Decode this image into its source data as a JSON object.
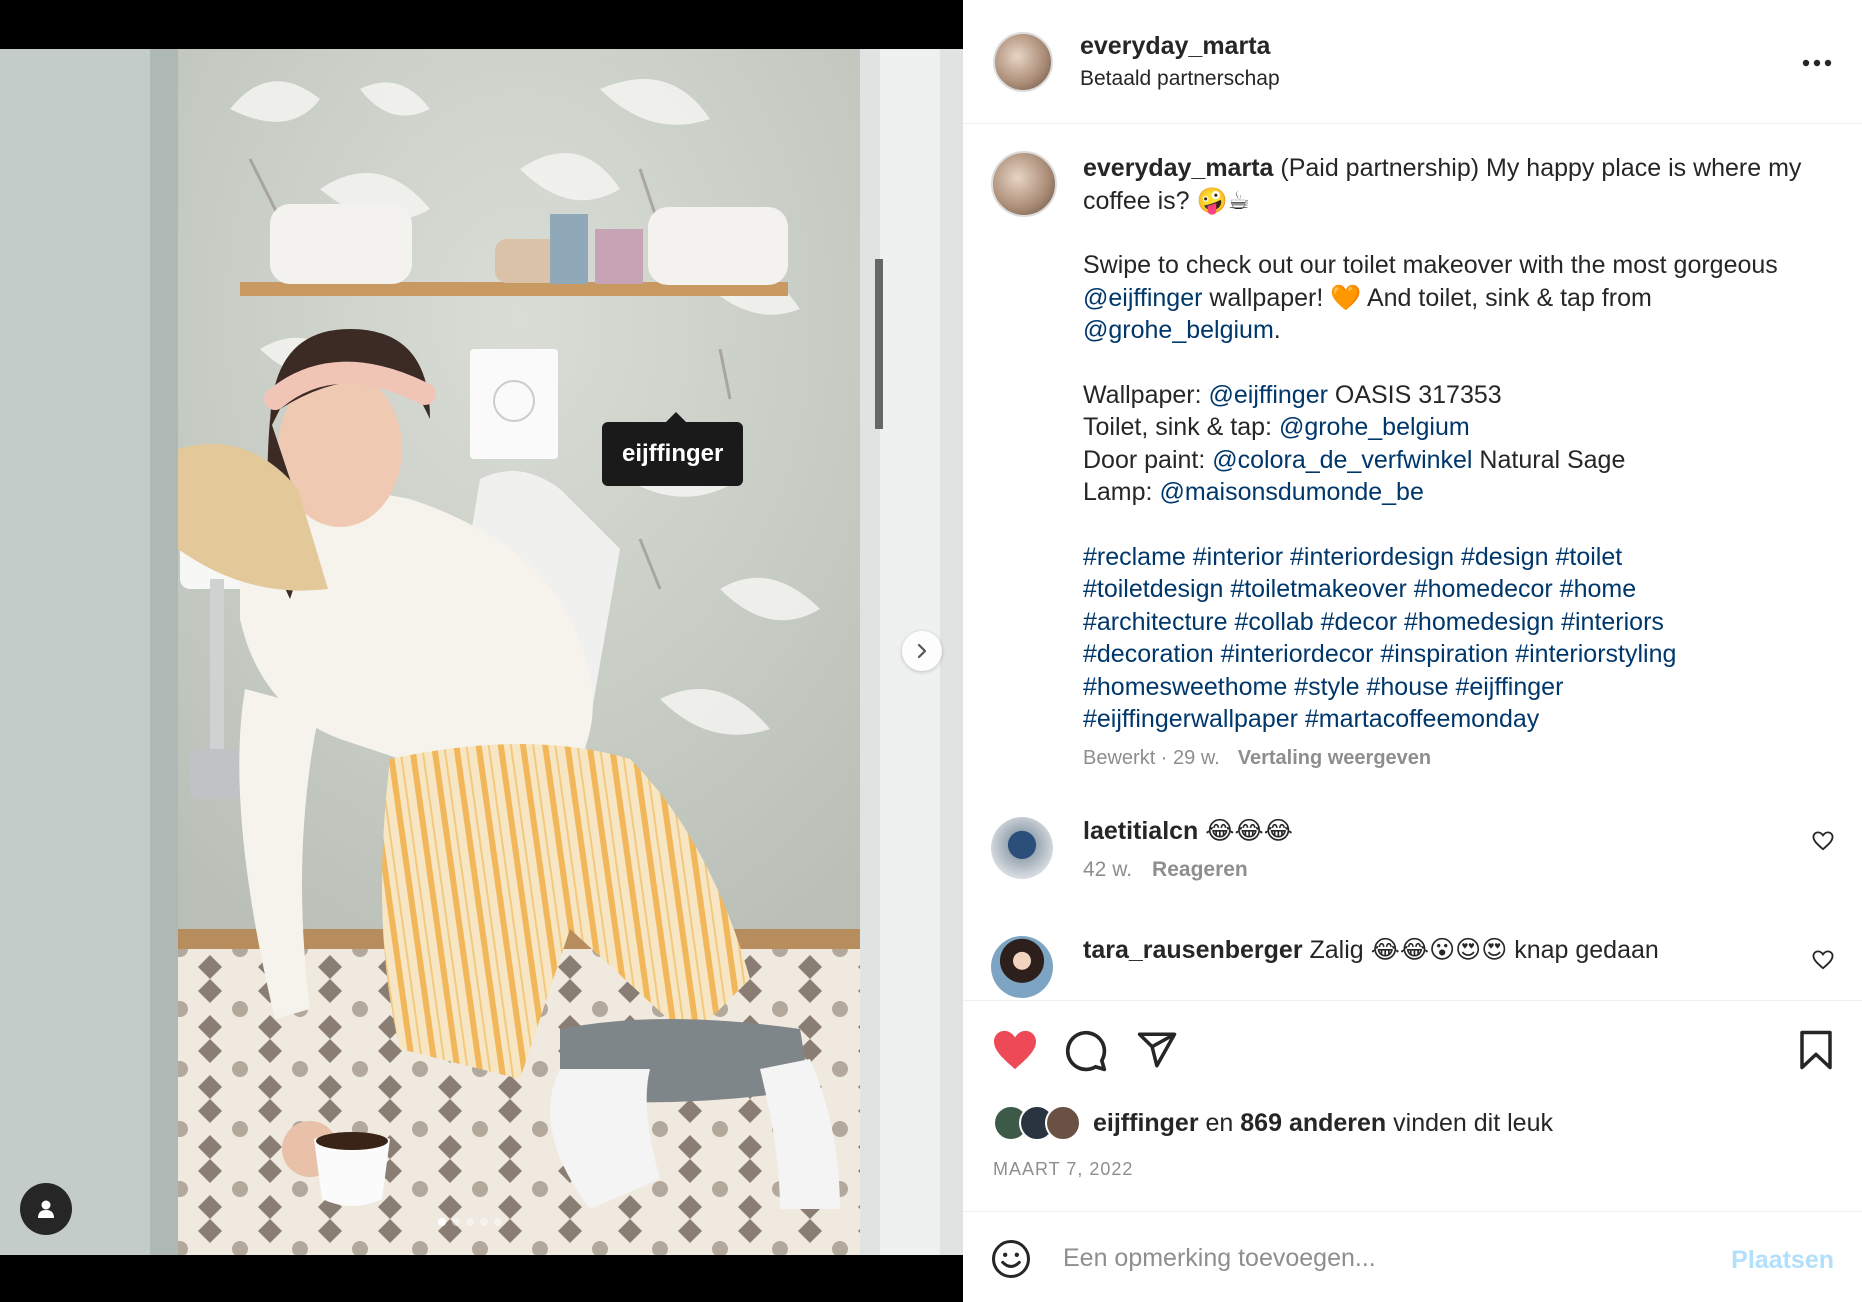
{
  "post": {
    "author": "everyday_marta",
    "subtitle": "Betaald partnerschap",
    "more_label": "...",
    "tag_label": "eijffinger",
    "media_count": 5,
    "active_media_index": 0
  },
  "caption": {
    "author": "everyday_marta",
    "line1": " (Paid partnership) My happy place is where my coffee is? 🤪☕",
    "p2_a": "Swipe to check out our toilet makeover with the most gorgeous ",
    "p2_mention1": "@eijffinger",
    "p2_b": " wallpaper! 🧡 And toilet, sink & tap from ",
    "p2_mention2": "@grohe_belgium",
    "p2_c": ".",
    "wallpaper_label": "Wallpaper: ",
    "wallpaper_mention": "@eijffinger",
    "wallpaper_value": " OASIS 317353",
    "toilet_label": "Toilet, sink & tap: ",
    "toilet_mention": "@grohe_belgium",
    "door_label": "Door paint: ",
    "door_mention": "@colora_de_verfwinkel",
    "door_value": " Natural Sage",
    "lamp_label": "Lamp: ",
    "lamp_mention": "@maisonsdumonde_be",
    "hashtags_line1": "#reclame #interior #interiordesign #design #toilet",
    "hashtags_line2": "#toiletdesign #toiletmakeover #homedecor #home",
    "hashtags_line3": "#architecture #collab #decor #homedesign #interiors",
    "hashtags_line4": "#decoration #interiordecor #inspiration #interiorstyling",
    "hashtags_line5": "#homesweethome #style #house #eijffinger",
    "hashtags_line6": "#eijffingerwallpaper #martacoffeemonday",
    "edited": "Bewerkt · 29 w.",
    "translate": "Vertaling weergeven"
  },
  "comments": [
    {
      "user": "laetitialcn",
      "text": " 😂😂😂",
      "age": "42 w.",
      "reply": "Reageren"
    },
    {
      "user": "tara_rausenberger",
      "text": " Zalig 😂😂😮😍😍 knap gedaan"
    }
  ],
  "likes": {
    "first": "eijffinger",
    "connector": " en ",
    "others": "869 anderen",
    "suffix": " vinden dit leuk"
  },
  "date": "MAART 7, 2022",
  "comment_box": {
    "placeholder": "Een opmerking toevoegen...",
    "post_label": "Plaatsen"
  },
  "colors": {
    "heart": "#ed4956",
    "link": "#00376b",
    "muted": "#8e8e8e",
    "post_button": "#b2dffc"
  },
  "icons": [
    "heart-icon",
    "comment-icon",
    "share-icon",
    "bookmark-icon",
    "emoji-icon",
    "chevron-right-icon",
    "user-tag-icon",
    "more-icon"
  ]
}
